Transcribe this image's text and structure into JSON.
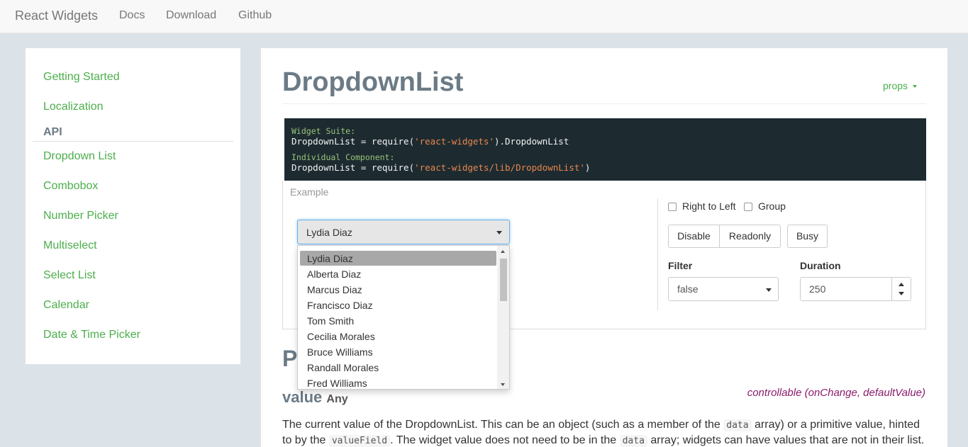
{
  "navbar": {
    "brand": "React Widgets",
    "links": [
      "Docs",
      "Download",
      "Github"
    ]
  },
  "sidebar": {
    "top_items": [
      "Getting Started",
      "Localization"
    ],
    "section_header": "API",
    "api_items": [
      "Dropdown List",
      "Combobox",
      "Number Picker",
      "Multiselect",
      "Select List",
      "Calendar",
      "Date & Time Picker"
    ]
  },
  "main": {
    "title": "DropdownList",
    "props_link": "props",
    "code": {
      "comment1": "Widget Suite:",
      "line1_prefix": "DropdownList = require(",
      "line1_string": "'react-widgets'",
      "line1_suffix": ").DropdownList",
      "comment2": "Individual Component:",
      "line2_prefix": "DropdownList = require(",
      "line2_string": "'react-widgets/lib/DropdownList'",
      "line2_suffix": ")"
    },
    "example_label": "Example",
    "dropdown_value": "Lydia Diaz",
    "dropdown_options": [
      "Lydia Diaz",
      "Alberta Diaz",
      "Marcus Diaz",
      "Francisco Diaz",
      "Tom Smith",
      "Cecilia Morales",
      "Bruce Williams",
      "Randall Morales",
      "Fred Williams"
    ],
    "checkboxes": [
      "Right to Left",
      "Group"
    ],
    "buttons": [
      "Disable",
      "Readonly",
      "Busy"
    ],
    "filter": {
      "label": "Filter",
      "value": "false"
    },
    "duration": {
      "label": "Duration",
      "value": "250"
    },
    "section_heading_partial": "P",
    "value_prop": {
      "name": "value",
      "type": "Any",
      "note": "controllable (onChange, defaultValue)"
    },
    "paragraph": {
      "l1a": "The current value of the DropdownList. This can be an object (such as a member of the ",
      "l1code": "data",
      "l1b": " array) or a primitive value, hinted",
      "l2a": "to by the ",
      "l2code1": "valueField",
      "l2b": ". The widget value does not need to be in the ",
      "l2code2": "data",
      "l2c": " array; widgets can have values that are not in their list."
    }
  },
  "colors": {
    "link_green": "#4cae4c",
    "heading_gray": "#6b7b86",
    "code_bg": "#1d2b31",
    "code_string": "#e8864b",
    "code_comment": "#98c379",
    "focus_blue": "#66afe9",
    "note_purple": "#8b1a6b"
  },
  "icons": [
    "caret-down-icon",
    "spin-up-icon",
    "spin-down-icon",
    "checkbox-icon"
  ]
}
